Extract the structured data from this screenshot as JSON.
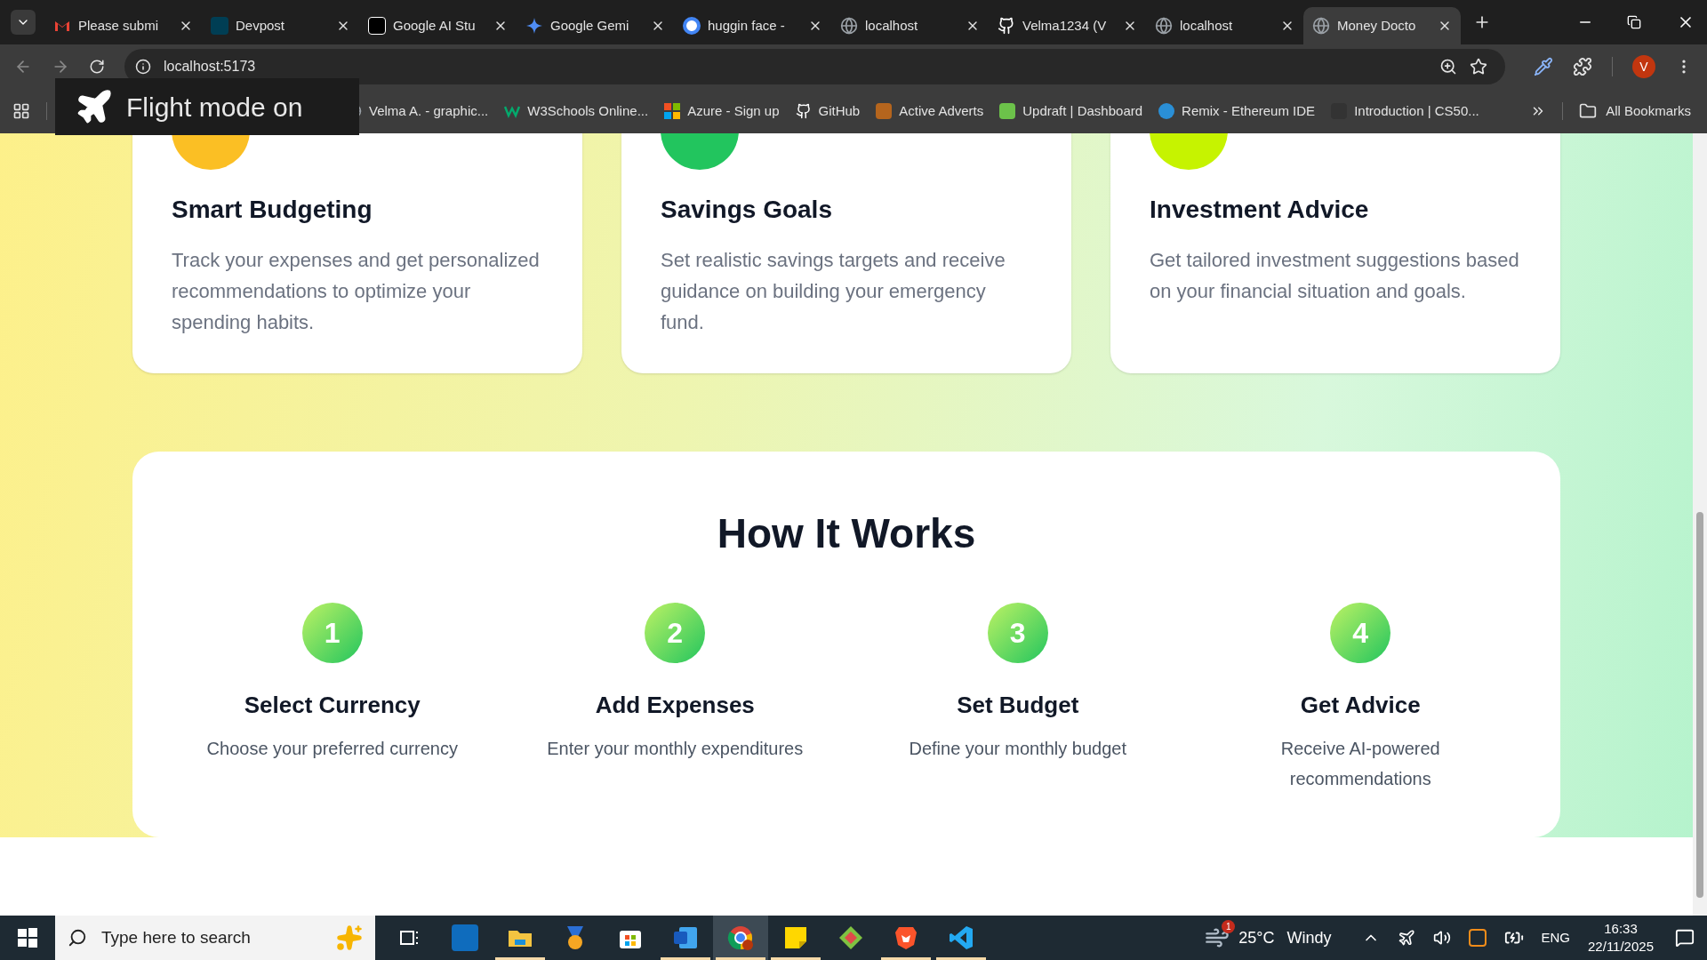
{
  "browser": {
    "tabs": [
      {
        "title": "Please submi",
        "selected": false
      },
      {
        "title": "Devpost",
        "selected": false
      },
      {
        "title": "Google AI Stu",
        "selected": false
      },
      {
        "title": "Google Gemi",
        "selected": false
      },
      {
        "title": "huggin face -",
        "selected": false
      },
      {
        "title": "localhost",
        "selected": false
      },
      {
        "title": "Velma1234 (V",
        "selected": false
      },
      {
        "title": "localhost",
        "selected": false
      },
      {
        "title": "Money Docto",
        "selected": true
      }
    ],
    "address": "localhost:5173",
    "profile_initial": "V",
    "bookmarks": [
      "Velma A. - graphic...",
      "W3Schools Online...",
      "Azure - Sign up",
      "GitHub",
      "Active Adverts",
      "Updraft | Dashboard",
      "Remix - Ethereum IDE",
      "Introduction | CS50..."
    ],
    "all_bookmarks": "All Bookmarks",
    "toast": "Flight mode on"
  },
  "features": [
    {
      "title": "Smart Budgeting",
      "description": "Track your expenses and get personalized recommendations to optimize your spending habits.",
      "color": "#fbbf24"
    },
    {
      "title": "Savings Goals",
      "description": "Set realistic savings targets and receive guidance on building your emergency fund.",
      "color": "#22c55e"
    },
    {
      "title": "Investment Advice",
      "description": "Get tailored investment suggestions based on your financial situation and goals.",
      "color": "#c6f300"
    }
  ],
  "how_it_works": {
    "title": "How It Works",
    "steps": [
      {
        "number": "1",
        "title": "Select Currency",
        "description": "Choose your preferred currency"
      },
      {
        "number": "2",
        "title": "Add Expenses",
        "description": "Enter your monthly expenditures"
      },
      {
        "number": "3",
        "title": "Set Budget",
        "description": "Define your monthly budget"
      },
      {
        "number": "4",
        "title": "Get Advice",
        "description": "Receive AI-powered recommendations"
      }
    ]
  },
  "taskbar": {
    "search_placeholder": "Type here to search",
    "apps": [
      {
        "running": false,
        "selected": false
      },
      {
        "running": false,
        "selected": false
      },
      {
        "running": true,
        "selected": false
      },
      {
        "running": false,
        "selected": false
      },
      {
        "running": false,
        "selected": false
      },
      {
        "running": true,
        "selected": false
      },
      {
        "running": true,
        "selected": true
      },
      {
        "running": true,
        "selected": false
      },
      {
        "running": false,
        "selected": false
      },
      {
        "running": true,
        "selected": false
      },
      {
        "running": true,
        "selected": false
      }
    ],
    "weather_badge": "1",
    "temperature": "25°C",
    "weather": "Windy",
    "language": "ENG",
    "time": "16:33",
    "date": "22/11/2025"
  }
}
